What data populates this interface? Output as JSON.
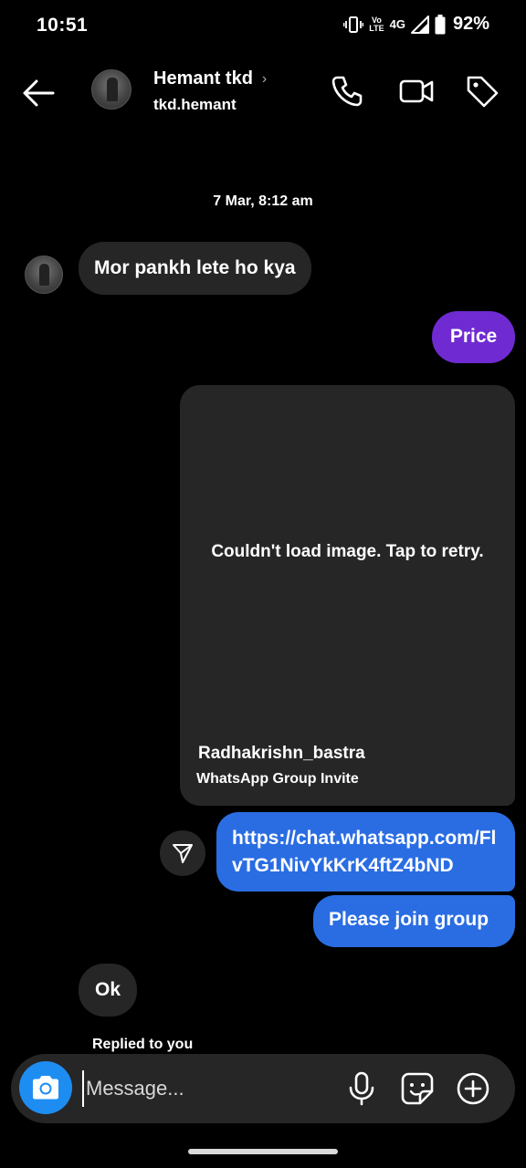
{
  "status_bar": {
    "time": "10:51",
    "volte_line1": "Vo",
    "volte_line2": "LTE",
    "network": "4G",
    "battery": "92%",
    "icons": [
      "vibrate-icon",
      "volte-icon",
      "signal-icon",
      "battery-icon"
    ]
  },
  "header": {
    "contact_name": "Hemant tkd",
    "chevron": "›",
    "username": "tkd.hemant",
    "icons": [
      "back-arrow-icon",
      "phone-icon",
      "video-camera-icon",
      "tag-icon"
    ]
  },
  "conversation": {
    "timestamp": "7 Mar, 8:12 am",
    "messages": [
      {
        "direction": "incoming",
        "text": "Mor pankh lete ho kya"
      },
      {
        "direction": "outgoing",
        "text": "Price"
      },
      {
        "direction": "outgoing",
        "type": "link_preview",
        "error_text": "Couldn't load image. Tap to retry.",
        "title": "Radhakrishn_bastra",
        "subtitle": "WhatsApp Group Invite"
      },
      {
        "direction": "outgoing",
        "text": "https://chat.whatsapp.com/FlvTG1NivYkKrK4ftZ4bND"
      },
      {
        "direction": "outgoing",
        "text": "Please join group"
      },
      {
        "direction": "incoming",
        "text": "Ok"
      }
    ],
    "replied_label": "Replied to you"
  },
  "composer": {
    "placeholder": "Message...",
    "icons": [
      "camera-icon",
      "microphone-icon",
      "sticker-icon",
      "plus-icon"
    ]
  },
  "colors": {
    "background": "#000000",
    "incoming_bubble": "#262626",
    "purple_bubble": "#6f2bd1",
    "blue_bubble": "#2a6de3",
    "camera_button": "#1e8df2"
  }
}
